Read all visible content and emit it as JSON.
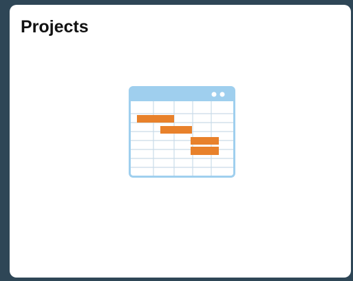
{
  "tile": {
    "title": "Projects",
    "icon": "gantt-chart-icon"
  },
  "colors": {
    "frame": "#2e4656",
    "tile_background": "#ffffff",
    "icon_header": "#9fcfee",
    "icon_grid": "#c9dbe8",
    "icon_bars": "#e8812b",
    "icon_header_dots": "#ffffff"
  }
}
